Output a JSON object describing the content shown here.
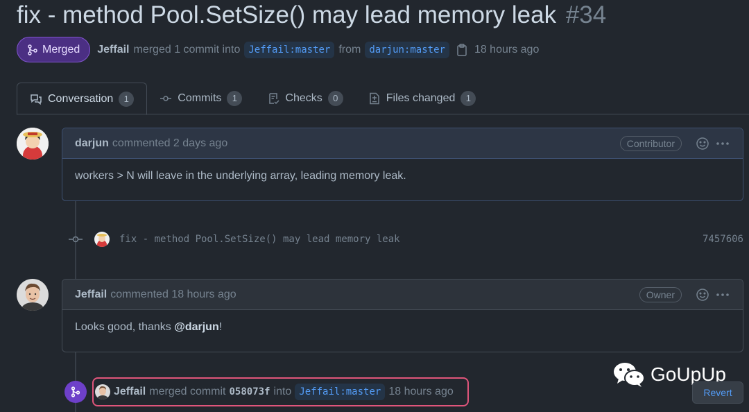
{
  "pr": {
    "title": "fix - method Pool.SetSize() may lead memory leak",
    "number": "#34",
    "state_label": "Merged",
    "merger": "Jeffail",
    "merged_text": "merged 1 commit into",
    "base_branch": "Jeffail:master",
    "from_text": "from",
    "head_branch": "darjun:master",
    "time": "18 hours ago"
  },
  "tabs": [
    {
      "label": "Conversation",
      "count": "1",
      "icon": "comment-discussion-icon",
      "active": true
    },
    {
      "label": "Commits",
      "count": "1",
      "icon": "git-commit-icon"
    },
    {
      "label": "Checks",
      "count": "0",
      "icon": "checklist-icon"
    },
    {
      "label": "Files changed",
      "count": "1",
      "icon": "file-diff-icon"
    }
  ],
  "comments": [
    {
      "author": "darjun",
      "when": "commented 2 days ago",
      "role": "Contributor",
      "body": "workers > N will leave in the underlying array, leading memory leak."
    },
    {
      "author": "Jeffail",
      "when": "commented 18 hours ago",
      "role": "Owner",
      "body_prefix": "Looks good, thanks ",
      "body_mention": "@darjun",
      "body_suffix": "!"
    }
  ],
  "commit": {
    "message": "fix - method Pool.SetSize() may lead memory leak",
    "sha": "7457606"
  },
  "merge_event": {
    "author": "Jeffail",
    "text": "merged commit",
    "sha": "058073f",
    "into": "into",
    "branch": "Jeffail:master",
    "time": "18 hours ago"
  },
  "revert_label": "Revert",
  "watermark": "GoUpUp",
  "colors": {
    "merged": "#6e40c9",
    "highlight_border": "#e0557b",
    "link": "#539bf5"
  }
}
